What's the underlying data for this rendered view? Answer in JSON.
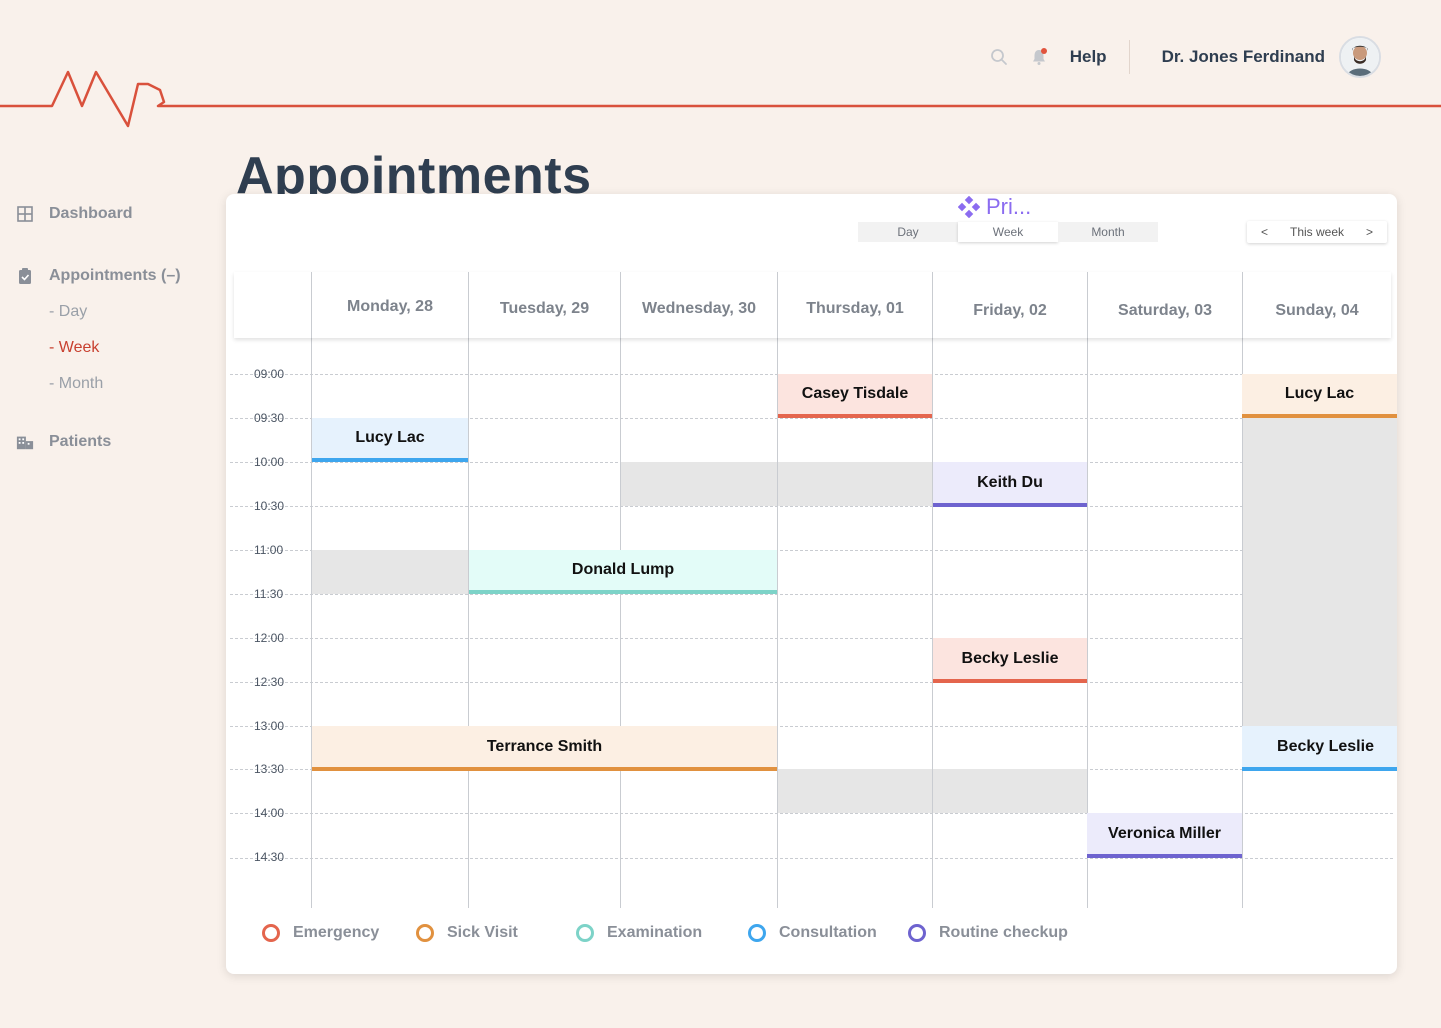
{
  "header": {
    "help_label": "Help",
    "doctor_name": "Dr. Jones Ferdinand",
    "icons": [
      "search-icon",
      "bell-icon",
      "avatar"
    ],
    "accent_color": "#d9513c"
  },
  "sidebar": {
    "dashboard": "Dashboard",
    "appointments": "Appointments (–)",
    "sub_day": "- Day",
    "sub_week": "- Week",
    "sub_month": "- Month",
    "patients": "Patients"
  },
  "page": {
    "title": "Appointments"
  },
  "calendar": {
    "view_label": "Pri...",
    "views": [
      "Day",
      "Week",
      "Month"
    ],
    "active_view": "Week",
    "nav_prev": "<",
    "nav_label": "This week",
    "nav_next": ">",
    "days": [
      "Monday, 28",
      "Tuesday, 29",
      "Wednesday, 30",
      "Thursday, 01",
      "Friday, 02",
      "Saturday, 03",
      "Sunday, 04"
    ],
    "times": [
      "09:00",
      "09:30",
      "10:00",
      "10:30",
      "11:00",
      "11:30",
      "12:00",
      "12:30",
      "13:00",
      "13:30",
      "14:00",
      "14:30"
    ],
    "appointments": [
      {
        "name": "Casey Tisdale",
        "day": "Thursday, 01",
        "start": "09:00",
        "end": "09:30",
        "type": "Emergency"
      },
      {
        "name": "Lucy Lac",
        "day": "Sunday, 04",
        "start": "09:00",
        "end": "09:30",
        "type": "Sick Visit"
      },
      {
        "name": "Lucy Lac",
        "day": "Monday, 28",
        "start": "09:30",
        "end": "10:00",
        "type": "Consultation"
      },
      {
        "name": "Keith Du",
        "day": "Friday, 02",
        "start": "10:00",
        "end": "10:30",
        "type": "Routine checkup"
      },
      {
        "name": "Donald Lump",
        "day": "Tuesday, 29 – Wednesday, 30",
        "start": "11:00",
        "end": "11:30",
        "type": "Examination"
      },
      {
        "name": "Becky Leslie",
        "day": "Friday, 02",
        "start": "12:00",
        "end": "12:30",
        "type": "Emergency"
      },
      {
        "name": "Terrance Smith",
        "day": "Monday, 28 – Wednesday, 30",
        "start": "13:00",
        "end": "13:30",
        "type": "Sick Visit"
      },
      {
        "name": "Becky Leslie",
        "day": "Sunday, 04",
        "start": "13:00",
        "end": "13:30",
        "type": "Consultation"
      },
      {
        "name": "Veronica Miller",
        "day": "Saturday, 03",
        "start": "14:00",
        "end": "14:30",
        "type": "Routine checkup"
      }
    ]
  },
  "legend": [
    {
      "label": "Emergency",
      "color": "#e4654d"
    },
    {
      "label": "Sick Visit",
      "color": "#e1913f"
    },
    {
      "label": "Examination",
      "color": "#7dd3c8"
    },
    {
      "label": "Consultation",
      "color": "#3ea6ee"
    },
    {
      "label": "Routine checkup",
      "color": "#6e63cf"
    }
  ]
}
